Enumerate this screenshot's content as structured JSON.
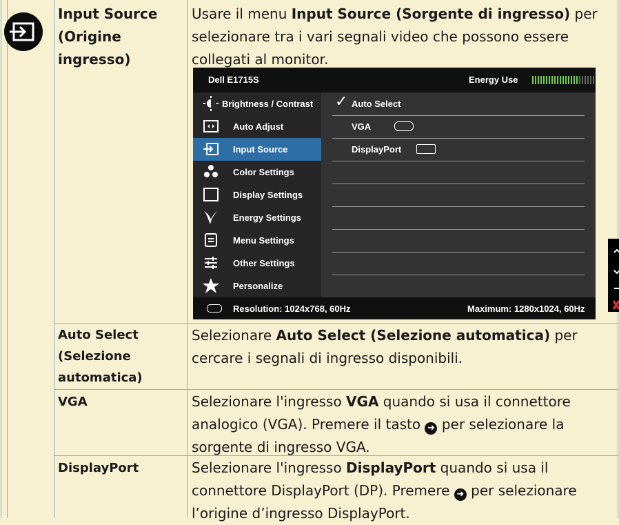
{
  "rows": [
    {
      "term": "Input Source (Origine ingresso)",
      "desc_parts": [
        "Usare il menu ",
        "Input Source (Sorgente di ingresso)",
        " per selezionare tra i vari segnali video che possono essere collegati al monitor."
      ]
    },
    {
      "term": "Auto Select (Selezione automatica)",
      "desc_parts": [
        "Selezionare ",
        "Auto Select (Selezione automatica)",
        " per cercare i segnali di ingresso disponibili."
      ]
    },
    {
      "term": "VGA",
      "desc_parts": [
        "Selezionare l'ingresso ",
        "VGA",
        " quando si usa il connettore analogico (VGA). Premere il tasto ",
        " per selezionare la sorgente di ingresso VGA."
      ]
    },
    {
      "term": "DisplayPort",
      "desc_parts": [
        "Selezionare l'ingresso ",
        "DisplayPort",
        " quando si usa il connettore DisplayPort (DP). Premere ",
        " per selezionare l’origine d’ingresso DisplayPort."
      ]
    }
  ],
  "osd": {
    "title": "Dell E1715S",
    "energy_label": "Energy Use",
    "menu": [
      {
        "label": "Brightness / Contrast",
        "icon": "brightness-icon"
      },
      {
        "label": "Auto Adjust",
        "icon": "auto-adjust-icon"
      },
      {
        "label": "Input Source",
        "icon": "input-source-icon",
        "active": true
      },
      {
        "label": "Color Settings",
        "icon": "color-settings-icon"
      },
      {
        "label": "Display Settings",
        "icon": "display-settings-icon"
      },
      {
        "label": "Energy Settings",
        "icon": "energy-settings-icon"
      },
      {
        "label": "Menu Settings",
        "icon": "menu-settings-icon"
      },
      {
        "label": "Other Settings",
        "icon": "other-settings-icon"
      },
      {
        "label": "Personalize",
        "icon": "star-icon"
      }
    ],
    "options": [
      {
        "label": "Auto Select",
        "checked": true
      },
      {
        "label": "VGA",
        "connector": "vga-connector-icon"
      },
      {
        "label": "DisplayPort",
        "connector": "displayport-connector-icon"
      }
    ],
    "footer_resolution": "Resolution: 1024x768, 60Hz",
    "footer_max": "Maximum: 1280x1024, 60Hz",
    "colors": {
      "active": "#2e6ea7",
      "meter": "#6fd34a"
    }
  },
  "colors": {
    "page_bg": "#f7f1d2",
    "grid": "#7fb0d3"
  }
}
